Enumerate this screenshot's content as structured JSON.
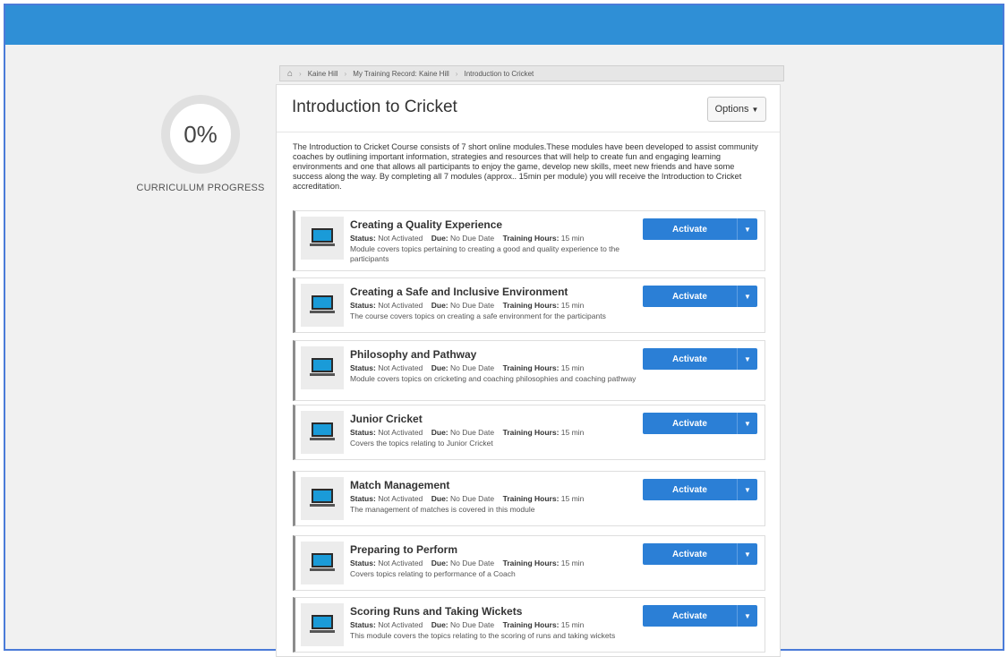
{
  "header": {
    "color": "#2f8fd6"
  },
  "progress": {
    "value": "0%",
    "label": "CURRICULUM PROGRESS"
  },
  "breadcrumb": {
    "home_icon": "home-icon",
    "items": [
      "Kaine Hill",
      "My Training Record: Kaine Hill",
      "Introduction to Cricket"
    ]
  },
  "course": {
    "title": "Introduction to Cricket",
    "options_label": "Options",
    "description": "The Introduction to Cricket Course consists of 7 short online modules.These modules have been developed to assist community coaches by outlining important information, strategies and resources that will help to create fun and engaging learning environments and one that allows all participants to enjoy the game, develop new skills, meet new friends and have some success along the way. By completing all 7 modules (approx.. 15min per module) you will receive the Introduction to Cricket accreditation."
  },
  "labels": {
    "status": "Status:",
    "due": "Due:",
    "hours": "Training Hours:",
    "activate": "Activate"
  },
  "modules": [
    {
      "title": "Creating a Quality Experience",
      "status": "Not Activated",
      "due": "No Due Date",
      "hours": "15 min",
      "description": "Module covers topics pertaining to creating a good and quality experience to the participants"
    },
    {
      "title": "Creating a Safe and Inclusive Environment",
      "status": "Not Activated",
      "due": "No Due Date",
      "hours": "15 min",
      "description": "The course covers topics on creating a safe environment for the participants"
    },
    {
      "title": "Philosophy and Pathway",
      "status": "Not Activated",
      "due": "No Due Date",
      "hours": "15 min",
      "description": "Module covers topics on cricketing and coaching philosophies and coaching pathway"
    },
    {
      "title": "Junior Cricket",
      "status": "Not Activated",
      "due": "No Due Date",
      "hours": "15 min",
      "description": "Covers the topics relating to Junior Cricket"
    },
    {
      "title": "Match Management",
      "status": "Not Activated",
      "due": "No Due Date",
      "hours": "15 min",
      "description": "The management of matches is covered in this module"
    },
    {
      "title": "Preparing to Perform",
      "status": "Not Activated",
      "due": "No Due Date",
      "hours": "15 min",
      "description": "Covers topics relating to performance of a Coach"
    },
    {
      "title": "Scoring Runs and Taking Wickets",
      "status": "Not Activated",
      "due": "No Due Date",
      "hours": "15 min",
      "description": "This module covers the topics relating to the scoring of runs and taking wickets"
    }
  ]
}
